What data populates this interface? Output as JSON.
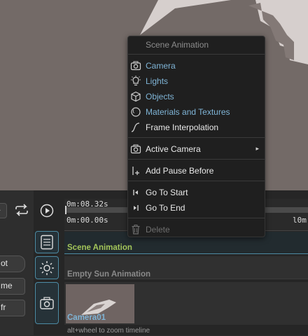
{
  "menu": {
    "title": "Scene Animation",
    "items": [
      {
        "label": "Camera",
        "icon": "camera-icon",
        "color": "#7fb4d6"
      },
      {
        "label": "Lights",
        "icon": "light-bulb-icon",
        "color": "#7fb4d6"
      },
      {
        "label": "Objects",
        "icon": "cube-icon",
        "color": "#7fb4d6"
      },
      {
        "label": "Materials and Textures",
        "icon": "sphere-icon",
        "color": "#7fb4d6"
      },
      {
        "label": "Frame Interpolation",
        "icon": "curve-icon",
        "color": "#e8e8e8"
      },
      {
        "label": "Active Camera",
        "icon": "camera-icon",
        "color": "#e8e8e8",
        "submenu_indicator": "▸"
      },
      {
        "label": "Add Pause Before",
        "icon": "add-pause-icon",
        "color": "#e8e8e8"
      },
      {
        "label": "Go To Start",
        "icon": "skip-start-icon",
        "color": "#e8e8e8"
      },
      {
        "label": "Go To End",
        "icon": "skip-end-icon",
        "color": "#e8e8e8"
      },
      {
        "label": "Delete",
        "icon": "trash-icon",
        "color": "#6f6f6f",
        "disabled": true
      }
    ]
  },
  "left_panel": {
    "control_1": "ot",
    "control_2": "me",
    "control_3": "fr"
  },
  "timeline": {
    "current_time": "0m:08.32s",
    "start_time": "0m:00.00s",
    "end_time_partial": "l0m",
    "tracks": [
      {
        "label": "Scene Animation",
        "color": "#a3c55a"
      },
      {
        "label": "Empty Sun Animation",
        "color": "#8a8a8a"
      },
      {
        "label": "Camera01",
        "color": "#7fb4d6"
      }
    ],
    "hint": "alt+wheel to zoom timeline"
  },
  "colors": {
    "viewport": "#736a67",
    "accent": "#4d8ba4",
    "scene_track": "#a3c55a",
    "link_blue": "#7fb4d6"
  }
}
